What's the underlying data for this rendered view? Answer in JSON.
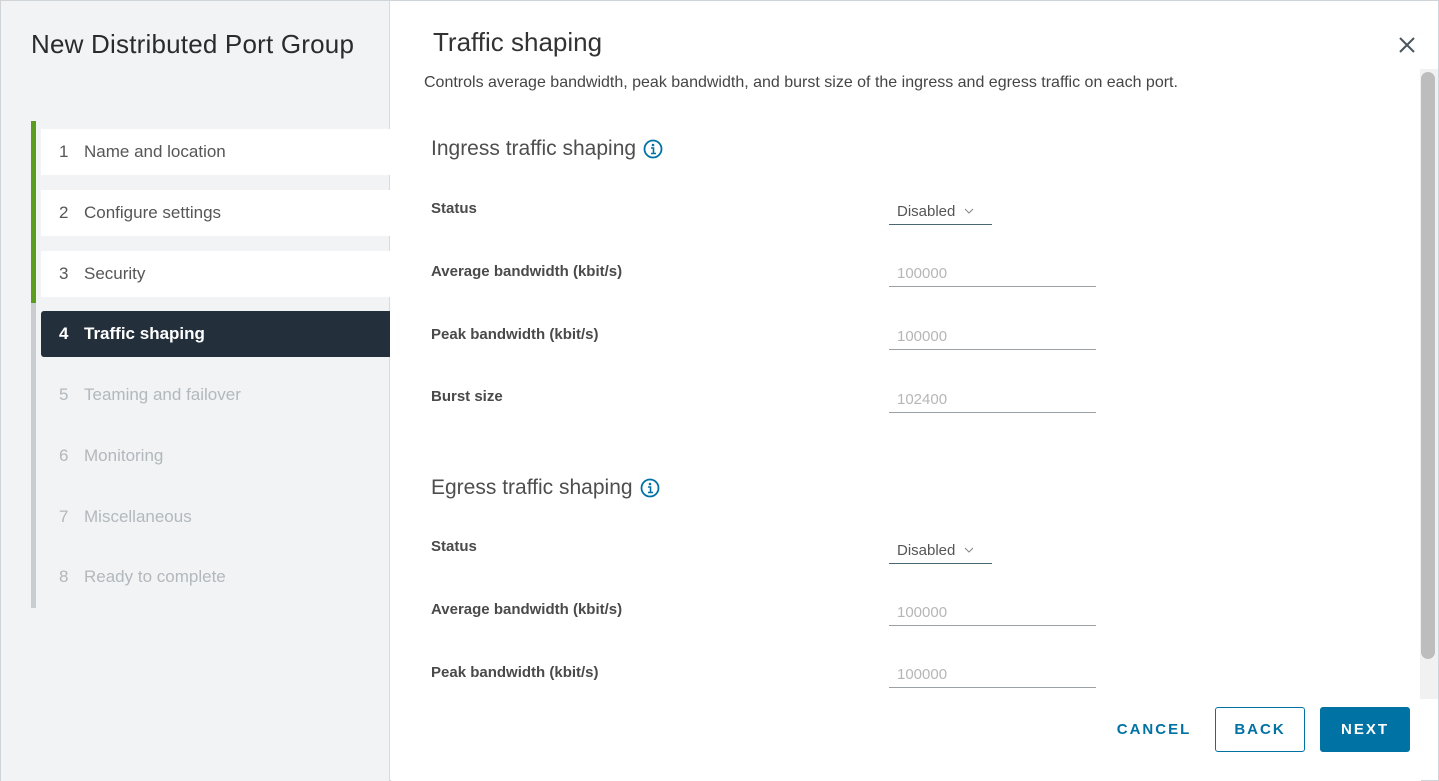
{
  "wizard": {
    "title": "New Distributed Port Group",
    "steps": [
      {
        "number": "1",
        "label": "Name and location",
        "state": "done"
      },
      {
        "number": "2",
        "label": "Configure settings",
        "state": "done"
      },
      {
        "number": "3",
        "label": "Security",
        "state": "done"
      },
      {
        "number": "4",
        "label": "Traffic shaping",
        "state": "active"
      },
      {
        "number": "5",
        "label": "Teaming and failover",
        "state": "pending"
      },
      {
        "number": "6",
        "label": "Monitoring",
        "state": "pending"
      },
      {
        "number": "7",
        "label": "Miscellaneous",
        "state": "pending"
      },
      {
        "number": "8",
        "label": "Ready to complete",
        "state": "pending"
      }
    ]
  },
  "page": {
    "title": "Traffic shaping",
    "description": "Controls average bandwidth, peak bandwidth, and burst size of the ingress and egress traffic on each port.",
    "close_icon": "close-icon"
  },
  "ingress": {
    "title": "Ingress traffic shaping",
    "info_icon": "info-icon",
    "status_label": "Status",
    "status_value": "Disabled",
    "avg_label": "Average bandwidth (kbit/s)",
    "avg_placeholder": "100000",
    "peak_label": "Peak bandwidth (kbit/s)",
    "peak_placeholder": "100000",
    "burst_label": "Burst size",
    "burst_placeholder": "102400"
  },
  "egress": {
    "title": "Egress traffic shaping",
    "info_icon": "info-icon",
    "status_label": "Status",
    "status_value": "Disabled",
    "avg_label": "Average bandwidth (kbit/s)",
    "avg_placeholder": "100000",
    "peak_label": "Peak bandwidth (kbit/s)",
    "peak_placeholder": "100000"
  },
  "footer": {
    "cancel_label": "CANCEL",
    "back_label": "BACK",
    "next_label": "NEXT"
  },
  "colors": {
    "primary": "#0072a3",
    "step_done_bar": "#5a9e1d",
    "active_step_bg": "#23303c"
  }
}
